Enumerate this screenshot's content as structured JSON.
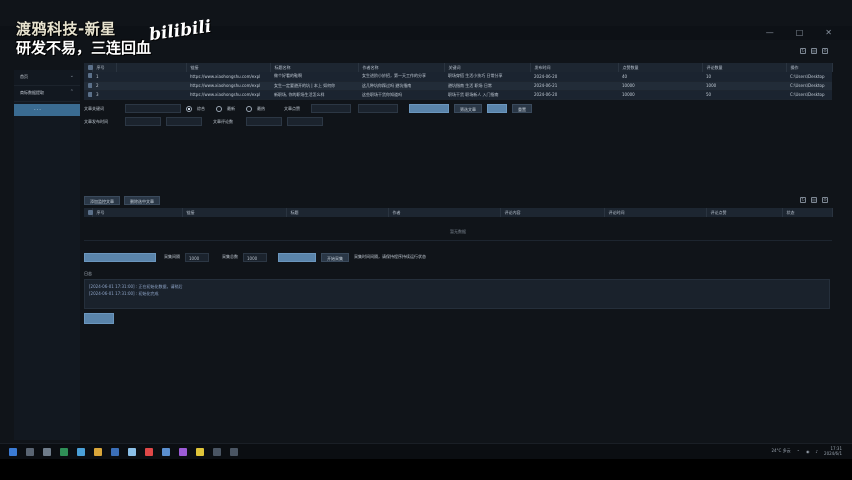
{
  "watermark": {
    "line1": "渡鸦科技-新星",
    "line2": "研发不易，三连回血",
    "brand": "bilibili"
  },
  "sidebar": {
    "items": [
      {
        "label": "首页",
        "chevron": "⌄"
      },
      {
        "label": "商标数据提取",
        "chevron": "⌃"
      }
    ],
    "sub_item": "- - -"
  },
  "top_table": {
    "headers": [
      "",
      "序号",
      "",
      "链接",
      "标题名称",
      "作者名称",
      "关键词",
      "发布时间",
      "点赞数量",
      "评论数量",
      "操作"
    ],
    "rows": [
      {
        "index": "1",
        "url": "https://www.xiaohongshu.com/expl",
        "title": "做个好看的鞋啊",
        "content": "女生进阶小妙招，第一天工作的分享",
        "tags": "职场穿搭 生活小技巧 日常分享",
        "date": "2024-06-20",
        "likes": "40",
        "comments": "10",
        "action": "C:\\Users\\Desktop"
      },
      {
        "index": "2",
        "url": "https://www.xiaohongshu.com/expl",
        "title": "女生一定要避开的坑 | 本上 如何你",
        "content": "这几种坑你踩过吗 避坑指南",
        "tags": "避坑指南 生活 职场 日常",
        "date": "2024-06-21",
        "likes": "10000",
        "comments": "1000",
        "action": "C:\\Users\\Desktop"
      },
      {
        "index": "3",
        "url": "https://www.xiaohongshu.com/expl",
        "title": "新职场, 你的职场生活怎么样",
        "content": "这些职场干货你知道吗",
        "tags": "职场干货 职场新人 入门指南",
        "date": "2024-06-20",
        "likes": "10000",
        "comments": "50",
        "action": "C:\\Users\\Desktop"
      }
    ]
  },
  "filters": {
    "row1": {
      "label": "文章关键词",
      "input": "",
      "radio1": "综合",
      "radio2": "最新",
      "radio3": "最热",
      "range_label": "文章点赞",
      "range_from": "",
      "range_to": "",
      "btn_blank": "",
      "btn_filter": "筛选文章",
      "btn_blank2": "",
      "btn_reset": "重置"
    },
    "row2": {
      "label": "文章发布时间",
      "from": "",
      "to": "",
      "label2": "文章评论数",
      "from2": "",
      "to2": ""
    }
  },
  "second_panel": {
    "btn1": "添加监控文章",
    "btn2": "删除选中文章",
    "headers": [
      "",
      "序号",
      "链接",
      "标题",
      "作者",
      "评论内容",
      "评论时间",
      "评论点赞",
      "状态"
    ],
    "empty_text": "暂无数据",
    "controls": {
      "btn_blank": "",
      "label1": "采集间隔",
      "val1": "1000",
      "label2": "采集总数",
      "val2": "1000",
      "btn_blank2": "",
      "btn_start": "开始采集",
      "hint": "采集时间间隔，请保持程序持续运行状态"
    }
  },
  "log": {
    "title": "日志",
    "lines": [
      "[2024-06-01 17:31:00] : 正在初始化数据，请稍后",
      "[2024-06-01 17:31:00] : 初始化完成"
    ],
    "btn": ""
  },
  "taskbar": {
    "weather": "24°C 多云",
    "time": "17:31",
    "date": "2024/6/1"
  },
  "colors": {
    "accent": "#5a84aa",
    "sidebar_active": "#3a6b91",
    "bg": "#101419"
  }
}
